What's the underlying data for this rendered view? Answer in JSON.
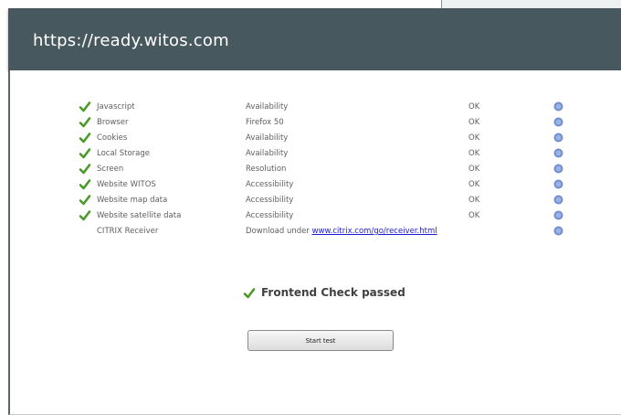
{
  "url": "https://ready.witos.com",
  "checks": [
    {
      "name": "Javascript",
      "aspect": "Availability",
      "status": "OK",
      "ok": true
    },
    {
      "name": "Browser",
      "aspect": "Firefox 50",
      "status": "OK",
      "ok": true
    },
    {
      "name": "Cookies",
      "aspect": "Availability",
      "status": "OK",
      "ok": true
    },
    {
      "name": "Local Storage",
      "aspect": "Availability",
      "status": "OK",
      "ok": true
    },
    {
      "name": "Screen",
      "aspect": "Resolution",
      "status": "OK",
      "ok": true
    },
    {
      "name": "Website WITOS",
      "aspect": "Accessibility",
      "status": "OK",
      "ok": true
    },
    {
      "name": "Website map data",
      "aspect": "Accessibility",
      "status": "OK",
      "ok": true
    },
    {
      "name": "Website satellite data",
      "aspect": "Accessibility",
      "status": "OK",
      "ok": true
    },
    {
      "name": "CITRIX Receiver",
      "aspect_prefix": "Download under",
      "aspect_link": "www.citrix.com/go/receiver.html",
      "status": "",
      "ok": false
    }
  ],
  "result": {
    "label": "Frontend Check passed"
  },
  "start_button": {
    "label": "Start test"
  },
  "colors": {
    "banner": "#48585f",
    "tick": "#4a9a2a",
    "info": "#6f8fd0",
    "link": "#1a1ad6"
  },
  "icons": {
    "tick": "check-icon",
    "info": "info-icon"
  }
}
